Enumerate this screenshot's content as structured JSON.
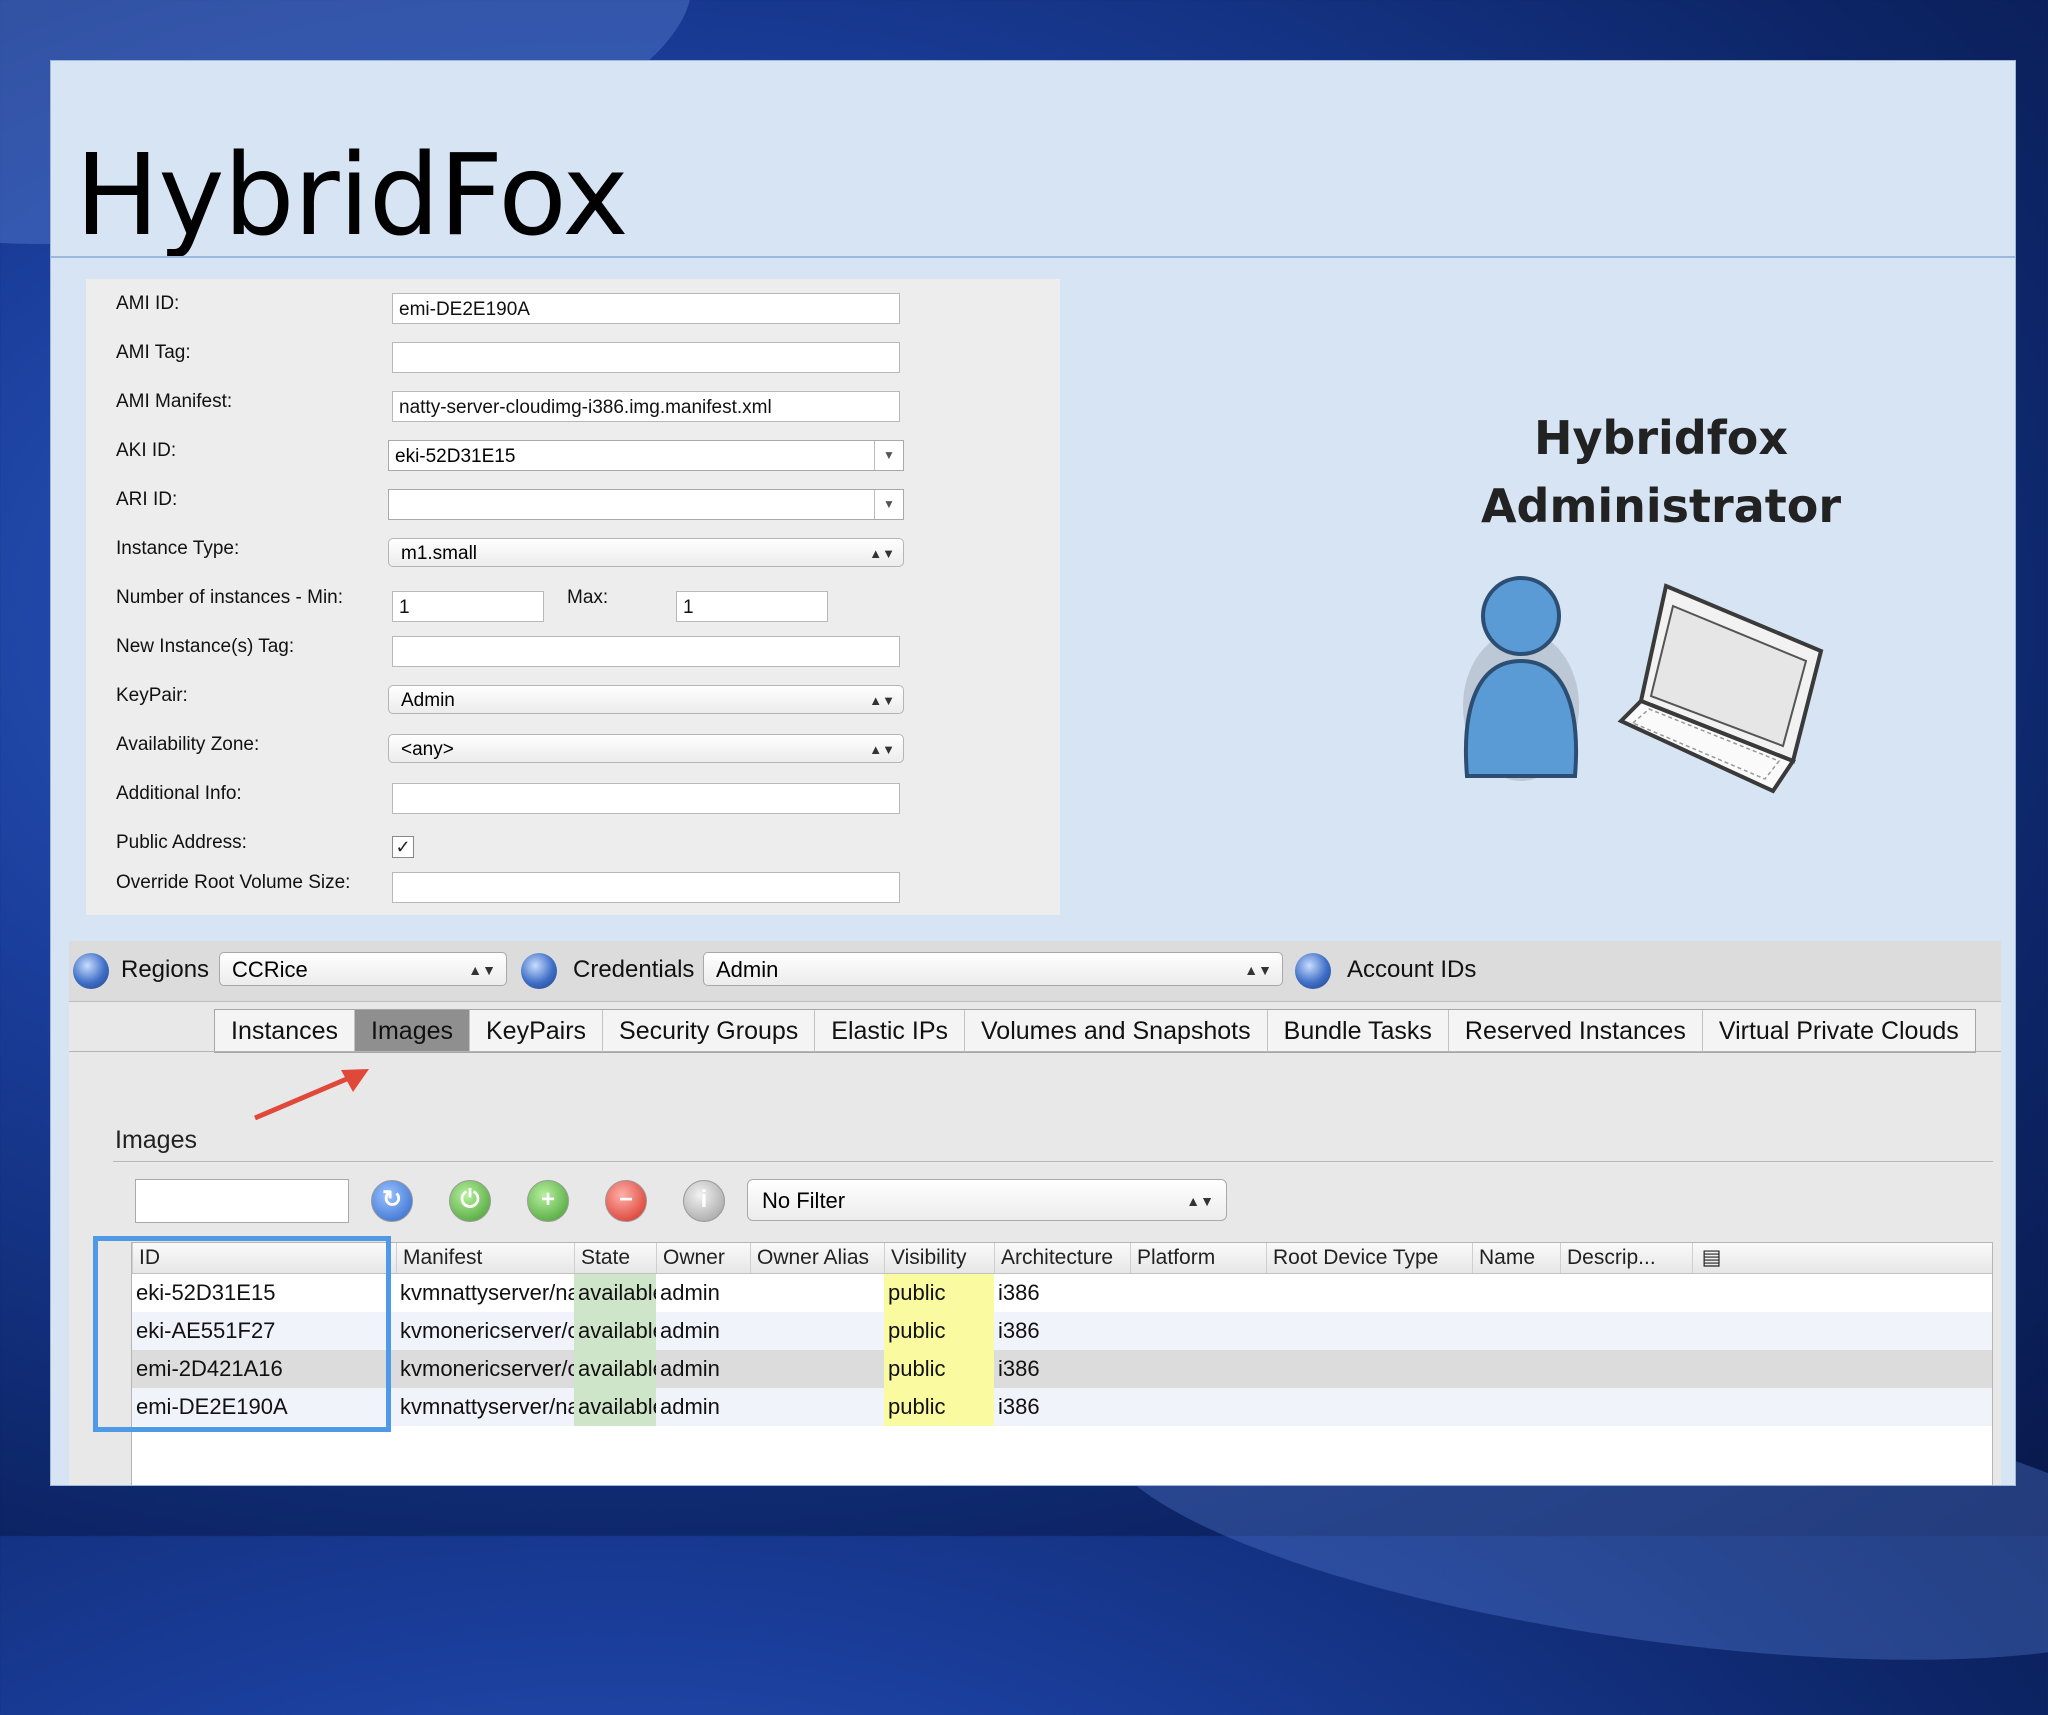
{
  "slide": {
    "title": "HybridFox"
  },
  "form": {
    "ami_id": {
      "label": "AMI ID:",
      "value": "emi-DE2E190A"
    },
    "ami_tag": {
      "label": "AMI Tag:",
      "value": ""
    },
    "ami_manifest": {
      "label": "AMI Manifest:",
      "value": "natty-server-cloudimg-i386.img.manifest.xml"
    },
    "aki_id": {
      "label": "AKI ID:",
      "value": "eki-52D31E15"
    },
    "ari_id": {
      "label": "ARI ID:",
      "value": ""
    },
    "instance_type": {
      "label": "Instance Type:",
      "value": "m1.small"
    },
    "num_instances": {
      "label": "Number of instances - Min:",
      "min": "1",
      "max_label": "Max:",
      "max": "1"
    },
    "new_instance_tag": {
      "label": "New Instance(s) Tag:",
      "value": ""
    },
    "keypair": {
      "label": "KeyPair:",
      "value": "Admin"
    },
    "availability_zone": {
      "label": "Availability Zone:",
      "value": "<any>"
    },
    "additional_info": {
      "label": "Additional Info:",
      "value": ""
    },
    "public_address": {
      "label": "Public Address:",
      "checked": true,
      "check_glyph": "✓"
    },
    "override_root": {
      "label": "Override Root Volume Size:",
      "value": ""
    }
  },
  "illustration": {
    "line1": "Hybridfox",
    "line2": "Administrator"
  },
  "toolbar": {
    "regions_label": "Regions",
    "regions_value": "CCRice",
    "credentials_label": "Credentials",
    "credentials_value": "Admin",
    "account_ids_label": "Account IDs"
  },
  "tabs": [
    "Instances",
    "Images",
    "KeyPairs",
    "Security Groups",
    "Elastic IPs",
    "Volumes and Snapshots",
    "Bundle Tasks",
    "Reserved Instances",
    "Virtual Private Clouds"
  ],
  "active_tab": "Images",
  "images": {
    "title": "Images",
    "search_value": "",
    "filter_value": "No Filter",
    "columns": [
      "ID",
      "Manifest",
      "State",
      "Owner",
      "Owner Alias",
      "Visibility",
      "Architecture",
      "Platform",
      "Root Device Type",
      "Name",
      "Descrip..."
    ],
    "rows": [
      {
        "id": "eki-52D31E15",
        "manifest": "kvmnattyserver/natty...",
        "state": "available",
        "owner": "admin",
        "owner_alias": "",
        "visibility": "public",
        "architecture": "i386"
      },
      {
        "id": "eki-AE551F27",
        "manifest": "kvmonericserver/onei...",
        "state": "available",
        "owner": "admin",
        "owner_alias": "",
        "visibility": "public",
        "architecture": "i386"
      },
      {
        "id": "emi-2D421A16",
        "manifest": "kvmonericserver/onei...",
        "state": "available",
        "owner": "admin",
        "owner_alias": "",
        "visibility": "public",
        "architecture": "i386"
      },
      {
        "id": "emi-DE2E190A",
        "manifest": "kvmnattyserver/natty...",
        "state": "available",
        "owner": "admin",
        "owner_alias": "",
        "visibility": "public",
        "architecture": "i386"
      }
    ]
  },
  "colors": {
    "state_bg": "#cfe5c9",
    "visibility_bg": "#fafaa0",
    "highlight_box": "#4f9ae6",
    "arrow": "#e0483a"
  }
}
